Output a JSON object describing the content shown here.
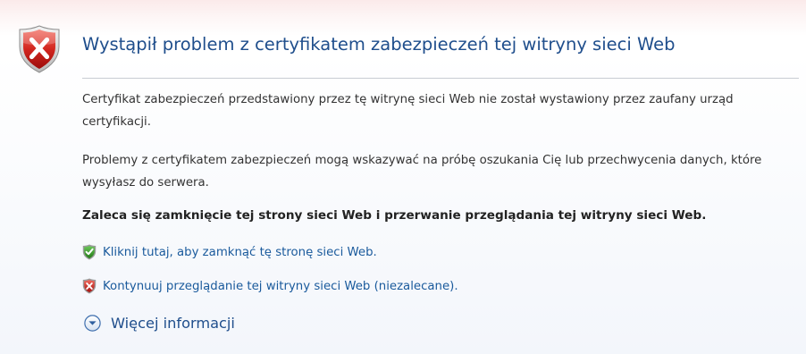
{
  "error": {
    "title": "Wystąpił problem z certyfikatem zabezpieczeń tej witryny sieci Web",
    "paragraph1": "Certyfikat zabezpieczeń przedstawiony przez tę witrynę sieci Web nie został wystawiony przez zaufany urząd certyfikacji.",
    "paragraph2": "Problemy z certyfikatem zabezpieczeń mogą wskazywać na próbę oszukania Cię lub przechwycenia danych, które wysyłasz do serwera.",
    "recommendation": "Zaleca się zamknięcie tej strony sieci Web i przerwanie przeglądania tej witryny sieci Web."
  },
  "actions": {
    "close_label": "Kliknij tutaj, aby zamknąć tę stronę sieci Web.",
    "continue_label": "Kontynuuj przeglądanie tej witryny sieci Web (niezalecane).",
    "more_info_label": "Więcej informacji"
  },
  "icons": {
    "main": "error-shield-icon",
    "close": "green-check-shield-icon",
    "continue": "red-x-shield-icon",
    "more": "expand-circle-icon"
  },
  "colors": {
    "title": "#1f4e8c",
    "link": "#1a5a9c",
    "error_red": "#c8191b",
    "safe_green": "#3a9a2a"
  }
}
